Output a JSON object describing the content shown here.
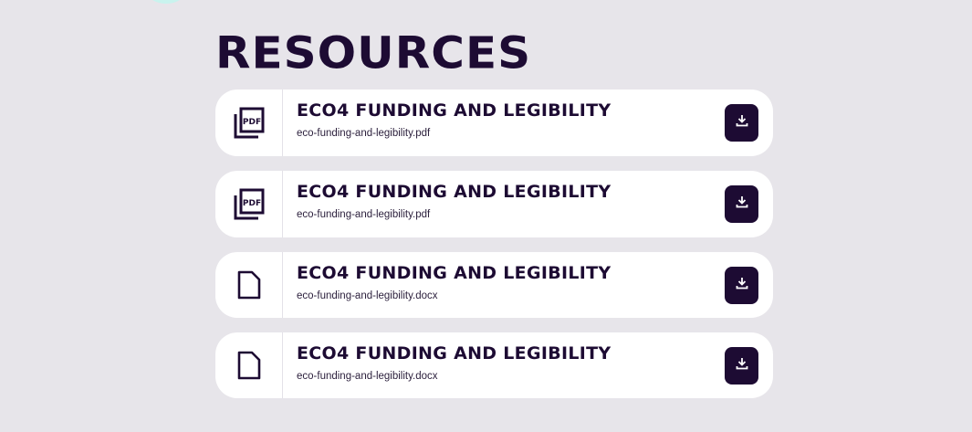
{
  "page": {
    "title": "RESOURCES"
  },
  "resources": [
    {
      "title": "ECO4 FUNDING AND LEGIBILITY",
      "filename": "eco-funding-and-legibility.pdf",
      "icon": "pdf-file-icon"
    },
    {
      "title": "ECO4 FUNDING AND LEGIBILITY",
      "filename": "eco-funding-and-legibility.pdf",
      "icon": "pdf-file-icon"
    },
    {
      "title": "ECO4 FUNDING AND LEGIBILITY",
      "filename": "eco-funding-and-legibility.docx",
      "icon": "document-icon"
    },
    {
      "title": "ECO4 FUNDING AND LEGIBILITY",
      "filename": "eco-funding-and-legibility.docx",
      "icon": "document-icon"
    }
  ],
  "icons": {
    "download": "download-icon"
  },
  "colors": {
    "background": "#e7e5ea",
    "primary": "#1d0b33",
    "card": "#ffffff"
  }
}
